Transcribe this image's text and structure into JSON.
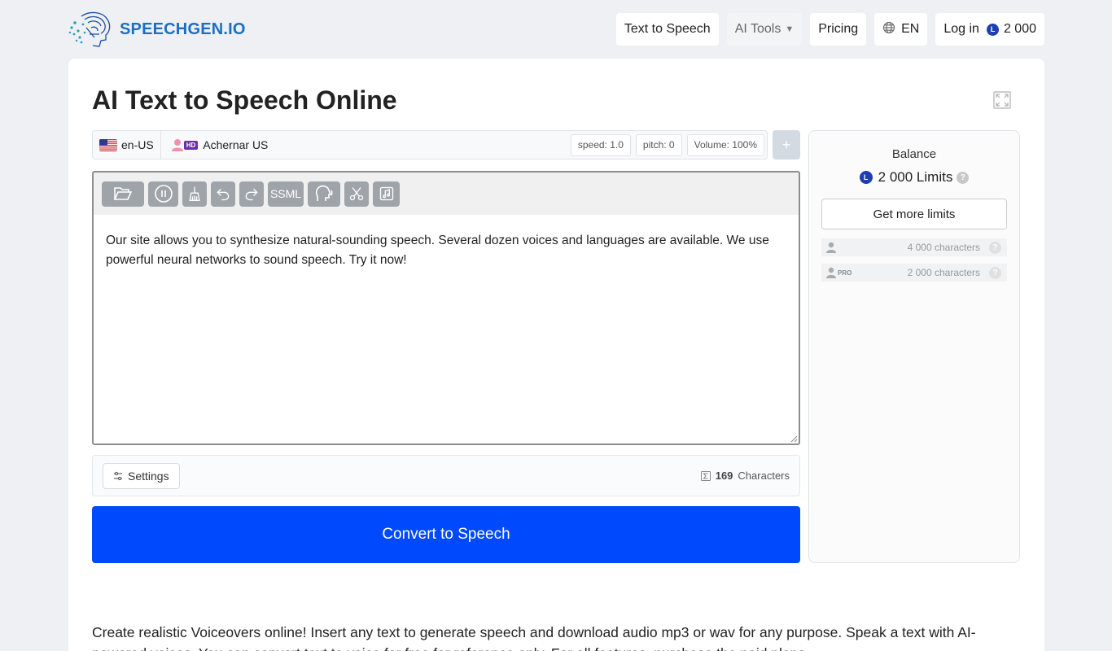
{
  "logo": {
    "text": "SPEECHGEN.IO"
  },
  "nav": {
    "text_to_speech": "Text to Speech",
    "ai_tools": "AI Tools",
    "pricing": "Pricing",
    "language": "EN",
    "login": "Log in",
    "balance": "2 000"
  },
  "page": {
    "title": "AI Text to Speech Online"
  },
  "voice": {
    "language": "en-US",
    "badge": "HD",
    "name": "Achernar US",
    "speed": "speed: 1.0",
    "pitch": "pitch: 0",
    "volume": "Volume: 100%",
    "add_label": "+"
  },
  "toolbar": {
    "ssml_label": "SSML"
  },
  "editor": {
    "text": "Our site allows you to synthesize natural-sounding speech. Several dozen voices and languages are available. We use powerful neural networks to sound speech. Try it now!"
  },
  "settings": {
    "label": "Settings",
    "char_count": "169",
    "char_label": "Characters"
  },
  "convert": {
    "label": "Convert to Speech"
  },
  "sidebar": {
    "balance_label": "Balance",
    "balance_value": "2 000 Limits",
    "coin_letter": "L",
    "help": "?",
    "get_more": "Get more limits",
    "limits": [
      {
        "amount": "4 000 characters"
      },
      {
        "badge": "PRO",
        "amount": "2 000 characters"
      }
    ]
  },
  "description": {
    "text": "Create realistic Voiceovers online! Insert any text to generate speech and download audio mp3 or wav for any purpose. Speak a text with AI-powered voices. You can convert text to voice for free for reference only. For all features, purchase the paid plans."
  },
  "colors": {
    "primary": "#0049fc",
    "brand": "#1b6fc2",
    "coin": "#1d3fb2",
    "hd_badge": "#6b2fa8"
  }
}
